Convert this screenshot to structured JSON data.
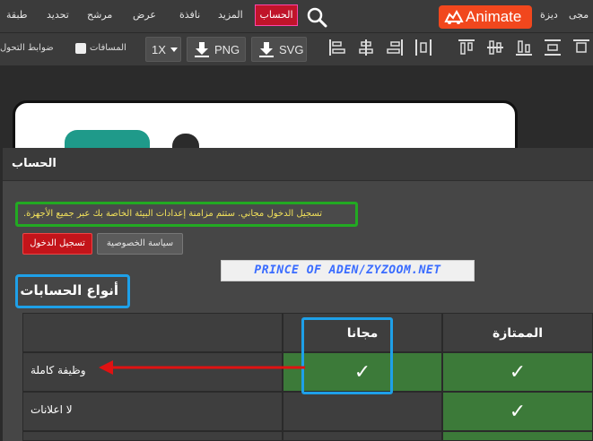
{
  "menubar": {
    "items": [
      "طبقة",
      "تحديد",
      "مرشح",
      "عرض",
      "نافذة",
      "المزيد",
      "الحساب",
      "ديزة",
      "مجى"
    ],
    "active": "الحساب",
    "animate_label": "Animate"
  },
  "toolbar": {
    "constraints": "ضوابط التحول",
    "distances": "المسافات",
    "zoom": "1X",
    "png": "PNG",
    "svg": "SVG"
  },
  "dialog": {
    "title": "الحساب",
    "info": "تسجيل الدخول مجاني. ستتم مزامنة إعدادات البيئة الخاصة بك عبر جميع الأجهزة.",
    "login": "تسجيل الدخول",
    "privacy": "سياسة الخصوصية",
    "watermark": "PRINCE OF ADEN/ZYZOOM.NET",
    "heading": "أنواع الحسابات"
  },
  "table": {
    "col_free": "مجانا",
    "col_premium": "الممتازة",
    "rows": [
      {
        "label": "وظيفة كاملة",
        "free": "✓",
        "premium": "✓"
      },
      {
        "label": "لا اعلانات",
        "free": "",
        "premium": "✓"
      }
    ]
  },
  "colors": {
    "accent": "#f1471d",
    "active_menu": "#c0142a",
    "highlight": "#1ea0e8",
    "check_green": "#3c7a39"
  }
}
